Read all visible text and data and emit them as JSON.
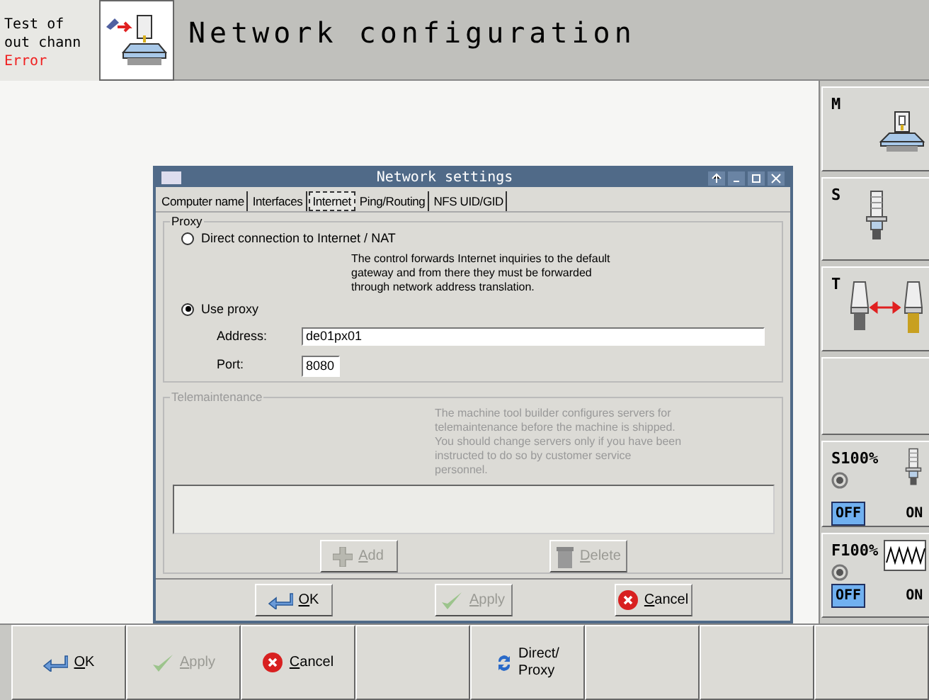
{
  "status": {
    "lines": [
      "Test of",
      "out chann"
    ],
    "error": "Error"
  },
  "title": "Network configuration",
  "dialog": {
    "title": "Network settings",
    "tabs": [
      {
        "label": "Computer name",
        "selected": false
      },
      {
        "label": "Interfaces",
        "selected": false
      },
      {
        "label": "Internet",
        "selected": true
      },
      {
        "label": "Ping/Routing",
        "selected": false
      },
      {
        "label": "NFS UID/GID",
        "selected": false
      }
    ],
    "proxy": {
      "legend": "Proxy",
      "options": [
        {
          "label": "Direct connection to Internet / NAT",
          "selected": false
        },
        {
          "label": "Use proxy",
          "selected": true
        }
      ],
      "note": "The control forwards Internet inquiries to the default gateway and from there they must be forwarded through network address translation.",
      "address_label": "Address:",
      "address": "de01px01",
      "port_label": "Port:",
      "port": "8080"
    },
    "telemaintenance": {
      "legend": "Telemaintenance",
      "disabled": true,
      "note": "The machine tool builder configures servers for telemaintenance before the machine is shipped. You should change servers only if you have been instructed to do so by customer service personnel.",
      "buttons": [
        {
          "kind": "add",
          "label": "Add",
          "disabled": true
        },
        {
          "kind": "delete",
          "label": "Delete",
          "disabled": true
        }
      ]
    },
    "buttons": [
      {
        "kind": "ok",
        "label": "OK",
        "disabled": false
      },
      {
        "kind": "apply",
        "label": "Apply",
        "disabled": true
      },
      {
        "kind": "cancel",
        "label": "Cancel",
        "disabled": false
      }
    ]
  },
  "side_keys": [
    {
      "kind": "machine",
      "label": "M"
    },
    {
      "kind": "spindle",
      "label": "S"
    },
    {
      "kind": "tool_change",
      "label": "T"
    },
    {
      "kind": "empty"
    },
    {
      "kind": "spindle_override",
      "label": "S100%",
      "switch": [
        {
          "label": "OFF",
          "selected": true
        },
        {
          "label": "ON",
          "selected": false
        }
      ]
    },
    {
      "kind": "feed_override",
      "label": "F100%",
      "switch": [
        {
          "label": "OFF",
          "selected": true
        },
        {
          "label": "ON",
          "selected": false
        }
      ]
    }
  ],
  "soft_keys": [
    {
      "kind": "ok",
      "label": "OK",
      "disabled": false
    },
    {
      "kind": "apply",
      "label": "Apply",
      "disabled": true
    },
    {
      "kind": "cancel",
      "label": "Cancel",
      "disabled": false
    },
    {
      "kind": "empty"
    },
    {
      "kind": "toggle",
      "lines": [
        "Direct/",
        "Proxy"
      ]
    },
    {
      "kind": "empty"
    },
    {
      "kind": "empty"
    },
    {
      "kind": "empty"
    }
  ]
}
